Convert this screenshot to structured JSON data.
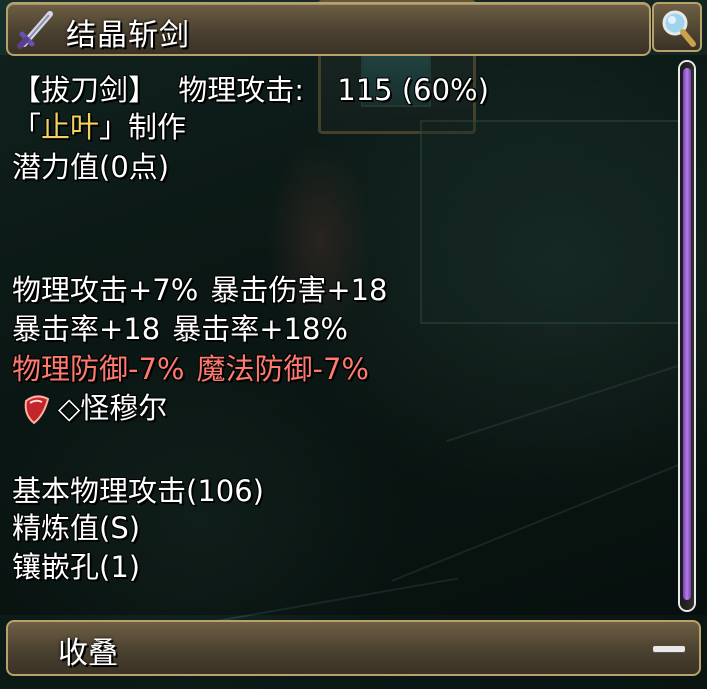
{
  "tooltip": {
    "title": "结晶斩剑",
    "icon": "sword-icon",
    "search_icon": "magnifier-icon"
  },
  "weapon_info": {
    "type_label": "【拔刀剑】",
    "attack_label": "物理攻击",
    "attack_colon": ":",
    "attack_value": "115 (60%)",
    "maker_open": "「",
    "maker_name": "止叶",
    "maker_close": "」制作",
    "potential": "潜力值(0点)"
  },
  "bonus_stats": {
    "line1_a": "物理攻击+7%",
    "line1_b": "暴击伤害+18",
    "line2_a": "暴击率+18",
    "line2_b": "暴击率+18%",
    "penalty_a": "物理防御-7%",
    "penalty_b": "魔法防御-7%",
    "gem_label": "◇怪穆尔",
    "gem_icon": "red-gem-icon"
  },
  "base_info": {
    "base_attack": "基本物理攻击(106)",
    "refine": "精炼值(S)",
    "sockets": "镶嵌孔(1)"
  },
  "footer": {
    "collapse_label": "收叠",
    "collapse_icon": "minus-icon"
  },
  "colors": {
    "penalty_text": "#ff7a6e",
    "maker_name": "#f3d163",
    "frame_gold": "#b8a16a",
    "scroll_thumb": "#b27ee8"
  }
}
